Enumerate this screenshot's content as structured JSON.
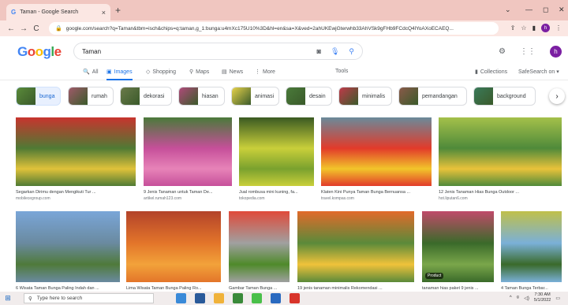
{
  "browser": {
    "tab_title": "Taman - Google Search",
    "tab_close": "×",
    "new_tab": "+",
    "url": "google.com/search?q=Taman&tbm=isch&chips=q:taman,g_1:bunga:u4mXc175U10%3D&hl=en&sa=X&ved=2ahUKEwjGterwhb33AhVSk9gFHb9FCdcQ4lYoAXoECAEQ...",
    "window_controls": [
      "⌄",
      "—",
      "◻",
      "✕"
    ]
  },
  "google": {
    "logo": "Google",
    "query": "Taman",
    "avatar_letter": "h"
  },
  "search_tabs": [
    {
      "label": "All",
      "icon": "🔍"
    },
    {
      "label": "Images",
      "icon": "▣"
    },
    {
      "label": "Shopping",
      "icon": "◇"
    },
    {
      "label": "Maps",
      "icon": "⚲"
    },
    {
      "label": "News",
      "icon": "▤"
    },
    {
      "label": "More",
      "icon": "⋮"
    }
  ],
  "tools_label": "Tools",
  "collections_label": "Collections",
  "safesearch_label": "SafeSearch on ▾",
  "chips": [
    {
      "label": "bunga",
      "color": "#5a8a3a"
    },
    {
      "label": "rumah",
      "color": "#a05a6a"
    },
    {
      "label": "dekorasi",
      "color": "#6a7a4a"
    },
    {
      "label": "hiasan",
      "color": "#b04a7a"
    },
    {
      "label": "animasi",
      "color": "#e6d24a"
    },
    {
      "label": "desain",
      "color": "#4a7a3a"
    },
    {
      "label": "minimalis",
      "color": "#c03a4a"
    },
    {
      "label": "pemandangan",
      "color": "#8a5a4a"
    },
    {
      "label": "background",
      "color": "#3a7a5a"
    }
  ],
  "images_row1": [
    {
      "caption": "Segarkan Dirimu dengan Mengikuti Tur ...",
      "source": "mobilecegroup.com",
      "colors": [
        "#4f7a34",
        "#e0c23a",
        "#c8342e"
      ]
    },
    {
      "caption": "9 Jenis Tanaman untuk Taman De...",
      "source": "artikel.rumah123.com",
      "colors": [
        "#c64f9a",
        "#e783b8",
        "#4a7a3a"
      ]
    },
    {
      "caption": "Jual rombusa mini kuning, fa...",
      "source": "tokopedia.com",
      "colors": [
        "#c9cf3a",
        "#7aa12e",
        "#3a5a22"
      ]
    },
    {
      "caption": "Klaten Kini Punya Taman Bunga Bernuansa ...",
      "source": "travel.kompas.com",
      "colors": [
        "#e23a2a",
        "#f2c52a",
        "#6a8a9a"
      ]
    },
    {
      "caption": "12 Jenis Tanaman Hias Bunga Outdoor ...",
      "source": "hot.liputan6.com",
      "colors": [
        "#4f8a3a",
        "#e9c23a",
        "#a4c04a"
      ]
    }
  ],
  "images_row2": [
    {
      "caption": "6 Wisata Taman Bunga Paling Indah dan ...",
      "source": "",
      "colors": [
        "#6a8aa0",
        "#4f7a3a",
        "#7aa6d8"
      ]
    },
    {
      "caption": "Lima Wisata Taman Bunga Paling Ro...",
      "source": "",
      "colors": [
        "#e3752a",
        "#f2a23a",
        "#b3432a"
      ]
    },
    {
      "caption": "Gambar Taman Bunga ...",
      "source": "",
      "colors": [
        "#a0a0a0",
        "#4f8a2a",
        "#e04a3a"
      ]
    },
    {
      "caption": "19 jenis tanaman minimalis Rekomendasi ...",
      "source": "",
      "colors": [
        "#5a8a3a",
        "#f0c23a",
        "#e26a2a"
      ]
    },
    {
      "caption": "tanaman hias paket 9 jenis ...",
      "source": "",
      "colors": [
        "#3a6a2a",
        "#7aa64a",
        "#c04a6a"
      ],
      "badge": "Product"
    },
    {
      "caption": "4 Taman Bunga Terbar...",
      "source": "",
      "colors": [
        "#7ab0d8",
        "#3a6a2a",
        "#c0c04a"
      ]
    }
  ],
  "taskbar": {
    "search_placeholder": "Type here to search",
    "time": "7:30 AM",
    "date": "5/1/2022",
    "apps": [
      "#3a8ad8",
      "#2a5a9a",
      "#f0b23a",
      "#3a8a3a",
      "#4ac04a",
      "#2a6ac0",
      "#d8342a"
    ]
  }
}
